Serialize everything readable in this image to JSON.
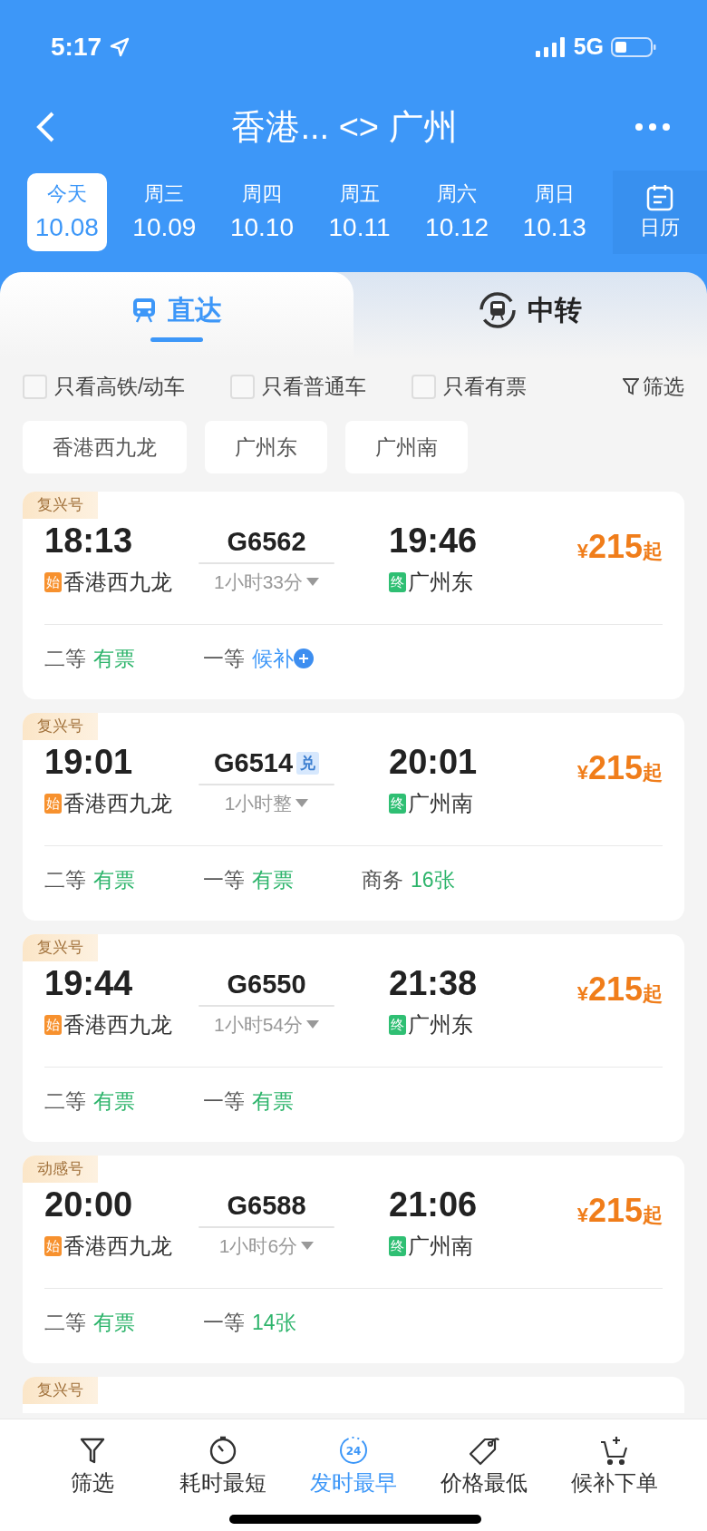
{
  "status_bar": {
    "time": "5:17",
    "network": "5G"
  },
  "header": {
    "title": "香港... <> 广州"
  },
  "dates": [
    {
      "weekday": "今天",
      "date": "10.08",
      "selected": true
    },
    {
      "weekday": "周三",
      "date": "10.09",
      "selected": false
    },
    {
      "weekday": "周四",
      "date": "10.10",
      "selected": false
    },
    {
      "weekday": "周五",
      "date": "10.11",
      "selected": false
    },
    {
      "weekday": "周六",
      "date": "10.12",
      "selected": false
    },
    {
      "weekday": "周日",
      "date": "10.13",
      "selected": false
    }
  ],
  "calendar_button": {
    "label": "日历"
  },
  "mode_tabs": [
    {
      "label": "直达",
      "selected": true
    },
    {
      "label": "中转",
      "selected": false
    }
  ],
  "filters": [
    {
      "label": "只看高铁/动车",
      "checked": false
    },
    {
      "label": "只看普通车",
      "checked": false
    },
    {
      "label": "只看有票",
      "checked": false
    }
  ],
  "filter_button": {
    "label": "筛选"
  },
  "stations": [
    "香港西九龙",
    "广州东",
    "广州南"
  ],
  "cards": [
    {
      "tag": "复兴号",
      "depart": "18:13",
      "train": "G6562",
      "arrive": "19:46",
      "duration": "1小时33分",
      "from_mark": "始",
      "from": "香港西九龙",
      "to_mark": "终",
      "to": "广州东",
      "currency": "¥",
      "price": "215",
      "price_suffix": "起",
      "seats": [
        {
          "class": "二等",
          "status": "有票",
          "kind": "available"
        },
        {
          "class": "一等",
          "status": "候补",
          "kind": "waitlist"
        }
      ]
    },
    {
      "tag": "复兴号",
      "depart": "19:01",
      "train": "G6514",
      "badge": "兑",
      "arrive": "20:01",
      "duration": "1小时整",
      "from_mark": "始",
      "from": "香港西九龙",
      "to_mark": "终",
      "to": "广州南",
      "currency": "¥",
      "price": "215",
      "price_suffix": "起",
      "seats": [
        {
          "class": "二等",
          "status": "有票",
          "kind": "available"
        },
        {
          "class": "一等",
          "status": "有票",
          "kind": "available"
        },
        {
          "class": "商务",
          "status": "16张",
          "kind": "available"
        }
      ]
    },
    {
      "tag": "复兴号",
      "depart": "19:44",
      "train": "G6550",
      "arrive": "21:38",
      "duration": "1小时54分",
      "from_mark": "始",
      "from": "香港西九龙",
      "to_mark": "终",
      "to": "广州东",
      "currency": "¥",
      "price": "215",
      "price_suffix": "起",
      "seats": [
        {
          "class": "二等",
          "status": "有票",
          "kind": "available"
        },
        {
          "class": "一等",
          "status": "有票",
          "kind": "available"
        }
      ]
    },
    {
      "tag": "动感号",
      "depart": "20:00",
      "train": "G6588",
      "arrive": "21:06",
      "duration": "1小时6分",
      "from_mark": "始",
      "from": "香港西九龙",
      "to_mark": "终",
      "to": "广州南",
      "currency": "¥",
      "price": "215",
      "price_suffix": "起",
      "seats": [
        {
          "class": "二等",
          "status": "有票",
          "kind": "available"
        },
        {
          "class": "一等",
          "status": "14张",
          "kind": "available"
        }
      ]
    }
  ],
  "next_card": {
    "tag": "复兴号"
  },
  "sort_bar": [
    {
      "label": "筛选",
      "kind": "filter",
      "selected": false
    },
    {
      "label": "耗时最短",
      "kind": "timer",
      "selected": false
    },
    {
      "label": "发时最早",
      "kind": "clock24",
      "icon_text": "24",
      "selected": true
    },
    {
      "label": "价格最低",
      "kind": "tag",
      "selected": false
    },
    {
      "label": "候补下单",
      "kind": "cart",
      "selected": false
    }
  ]
}
